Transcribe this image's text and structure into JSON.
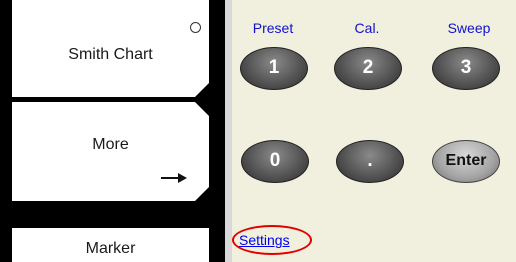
{
  "softkeys": [
    {
      "label": "Smith Chart"
    },
    {
      "label": "More"
    },
    {
      "label": "Marker"
    }
  ],
  "keypad": {
    "row1_labels": [
      "Preset",
      "Cal.",
      "Sweep"
    ],
    "row1_keys": [
      "1",
      "2",
      "3"
    ],
    "row2_keys": [
      "0",
      ".",
      "Enter"
    ],
    "settings_link": "Settings"
  },
  "colors": {
    "keypad_bg": "#f1efdd",
    "label_blue": "#1111cc",
    "highlight_red": "#e00000"
  },
  "icons": [
    "radio-circle-icon",
    "arrow-right-icon"
  ]
}
